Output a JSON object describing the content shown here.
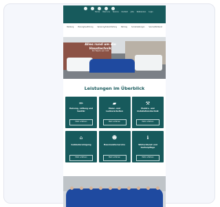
{
  "top_bar": {
    "social_icons": [
      "facebook-icon",
      "instagram-icon",
      "linkedin-icon",
      "mail-icon",
      "phone-icon"
    ],
    "links": [
      "Home",
      "Über uns",
      "Service",
      "Kontakt",
      "Jobs",
      "Referenzen",
      "Login"
    ]
  },
  "sub_nav": {
    "items": [
      "Beratung",
      "Planung/Ausführung",
      "Sanierung/Instandhaltung",
      "Wartung",
      "Sonderleistungen",
      "Service/Notdienst"
    ]
  },
  "hero": {
    "title": "Alles rund um die Haustechnik",
    "subtitle": "Ihr Team vor Ort"
  },
  "section": {
    "title": "Leistungen im Überblick"
  },
  "services": [
    {
      "icon": "plumbing-icon",
      "glyph": "✏",
      "title": "Heizung, Lüftung und Sanitär",
      "button": "Mehr erfahren"
    },
    {
      "icon": "paint-roller-icon",
      "glyph": "▰",
      "title": "Maler- und Lackierarbeiten",
      "button": "Mehr erfahren"
    },
    {
      "icon": "hammer-icon",
      "glyph": "⚒",
      "title": "Elektro- und Installationstechnik",
      "button": "Mehr erfahren"
    },
    {
      "icon": "home-icon",
      "glyph": "⌂",
      "title": "Gebäudereinigung",
      "button": "Mehr erfahren"
    },
    {
      "icon": "worker-icon",
      "glyph": "☻",
      "title": "Hausmeisterservice",
      "button": "Mehr erfahren"
    },
    {
      "icon": "info-icon",
      "glyph": "ℹ",
      "title": "Winterdienst und Gartenpflege",
      "button": "Mehr erfahren"
    }
  ],
  "colors": {
    "brand": "#175a5c",
    "page_background": "#f5f7fc"
  }
}
